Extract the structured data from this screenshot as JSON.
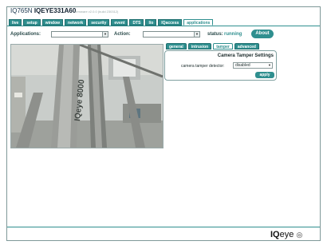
{
  "header": {
    "model_prefix": "IQ765N",
    "model_name": "IQEYE331A60",
    "firmware": "Firmware v2.0.0 (build 230312)"
  },
  "nav": {
    "tabs": [
      {
        "label": "live"
      },
      {
        "label": "setup"
      },
      {
        "label": "window"
      },
      {
        "label": "network"
      },
      {
        "label": "security"
      },
      {
        "label": "event"
      },
      {
        "label": "DTS"
      },
      {
        "label": "I/o"
      },
      {
        "label": "IQaccess"
      },
      {
        "label": "applications"
      }
    ],
    "active": "applications"
  },
  "toolbar": {
    "applications_label": "Applications:",
    "action_label": "Action:",
    "status_label": "status:",
    "status_value": "running",
    "about_label": "About"
  },
  "subtabs": {
    "items": [
      {
        "label": "general"
      },
      {
        "label": "intrusion"
      },
      {
        "label": "tamper"
      },
      {
        "label": "advanced"
      }
    ],
    "active": "tamper"
  },
  "panel": {
    "title": "Camera Tamper Settings",
    "detector_label": "camera tamper detector:",
    "detector_value": "disabled",
    "apply_label": "apply"
  },
  "video": {
    "overlay_text": "IQeye 8000"
  },
  "footer": {
    "logo_bold": "IQ",
    "logo_rest": "eye"
  },
  "colors": {
    "accent": "#2f8f8f",
    "status_running": "#2f8f8f"
  }
}
